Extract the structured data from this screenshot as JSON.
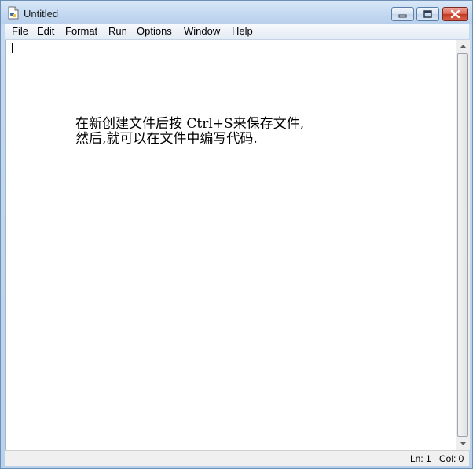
{
  "window": {
    "title": "Untitled",
    "app_icon": "python-idle-icon",
    "controls": [
      "minimize-icon",
      "maximize-icon",
      "close-icon"
    ]
  },
  "menubar": {
    "items": [
      {
        "label": "File"
      },
      {
        "label": "Edit"
      },
      {
        "label": "Format"
      },
      {
        "label": "Run"
      },
      {
        "label": "Options"
      },
      {
        "label": "Window"
      },
      {
        "label": "Help"
      }
    ]
  },
  "editor": {
    "line1": "在新创建文件后按 Ctrl+S来保存文件,",
    "line2": "然后,就可以在文件中编写代码."
  },
  "status": {
    "line": "Ln: 1",
    "col": "Col: 0"
  }
}
